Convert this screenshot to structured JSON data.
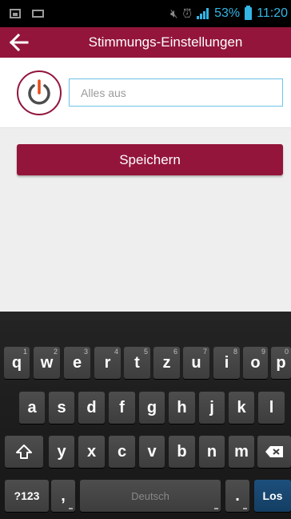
{
  "status_bar": {
    "battery": "53%",
    "time": "11:20"
  },
  "app_bar": {
    "title": "Stimmungs-Einstellungen",
    "back_icon": "arrow-left-icon"
  },
  "mood_form": {
    "power_icon": "power-icon",
    "name_placeholder": "Alles aus",
    "name_value": "",
    "save_label": "Speichern"
  },
  "keyboard": {
    "row1": [
      {
        "label": "q",
        "hint": "1"
      },
      {
        "label": "w",
        "hint": "2"
      },
      {
        "label": "e",
        "hint": "3"
      },
      {
        "label": "r",
        "hint": "4"
      },
      {
        "label": "t",
        "hint": "5"
      },
      {
        "label": "z",
        "hint": "6"
      },
      {
        "label": "u",
        "hint": "7"
      },
      {
        "label": "i",
        "hint": "8"
      },
      {
        "label": "o",
        "hint": "9"
      },
      {
        "label": "p",
        "hint": "0"
      }
    ],
    "row2": [
      "a",
      "s",
      "d",
      "f",
      "g",
      "h",
      "j",
      "k",
      "l"
    ],
    "row3": [
      "y",
      "x",
      "c",
      "v",
      "b",
      "n",
      "m"
    ],
    "symbols_label": "?123",
    "comma_label": ",",
    "space_label": "Deutsch",
    "period_label": ".",
    "enter_label": "Los"
  },
  "colors": {
    "brand": "#93153c",
    "input_border": "#6fc3e8",
    "status_accent": "#33b5e5",
    "enter_key": "#1c4f7c"
  }
}
